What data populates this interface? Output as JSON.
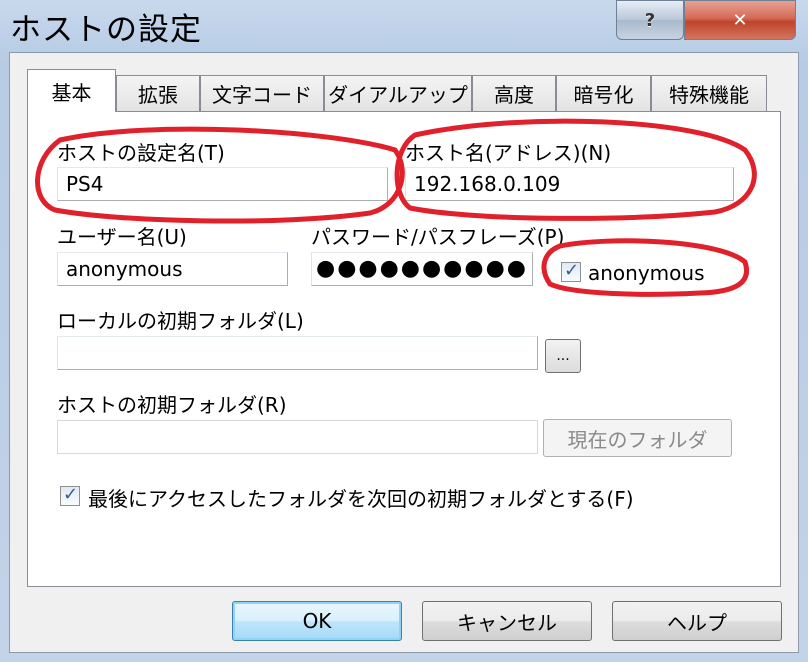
{
  "window": {
    "title": "ホストの設定",
    "help_glyph": "?",
    "close_glyph": "✕"
  },
  "tabs": [
    {
      "label": "基本",
      "active": true
    },
    {
      "label": "拡張"
    },
    {
      "label": "文字コード"
    },
    {
      "label": "ダイアルアップ"
    },
    {
      "label": "高度"
    },
    {
      "label": "暗号化"
    },
    {
      "label": "特殊機能"
    }
  ],
  "form": {
    "host_setting_name_label": "ホストの設定名(T)",
    "host_setting_name_value": "PS4",
    "host_name_label": "ホスト名(アドレス)(N)",
    "host_name_value": "192.168.0.109",
    "username_label": "ユーザー名(U)",
    "username_value": "anonymous",
    "password_label": "パスワード/パスフレーズ(P)",
    "password_value": "●●●●●●●●●●",
    "anonymous_label": "anonymous",
    "anonymous_checked": true,
    "local_folder_label": "ローカルの初期フォルダ(L)",
    "local_folder_value": "",
    "browse_label": "...",
    "host_folder_label": "ホストの初期フォルダ(R)",
    "host_folder_value": "",
    "current_folder_label": "現在のフォルダ",
    "last_folder_label": "最後にアクセスしたフォルダを次回の初期フォルダとする(F)",
    "last_folder_checked": true
  },
  "buttons": {
    "ok": "OK",
    "cancel": "キャンセル",
    "help": "ヘルプ"
  },
  "colors": {
    "annotation": "#e0202a"
  }
}
